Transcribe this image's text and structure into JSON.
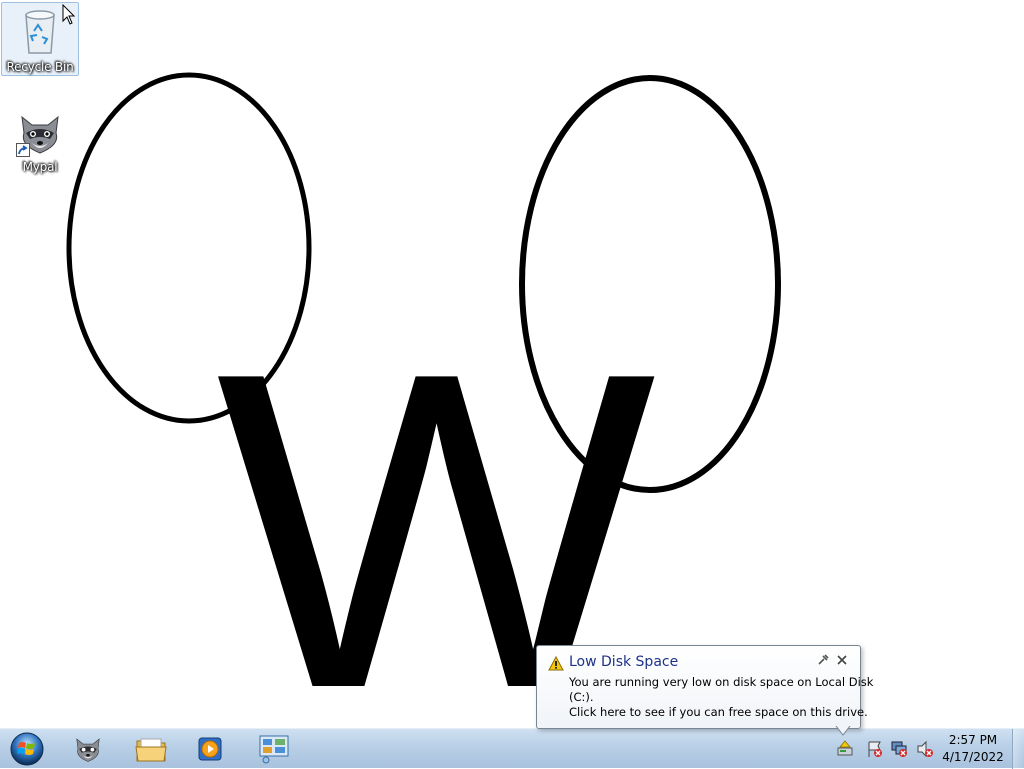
{
  "desktop": {
    "wallpaper_letter": "W",
    "icons": [
      {
        "label": "Recycle Bin",
        "icon": "recycle-bin-icon"
      },
      {
        "label": "Mypal",
        "icon": "raccoon-icon",
        "shortcut": true
      }
    ]
  },
  "notification": {
    "title": "Low Disk Space",
    "line1": "You are running very low on disk space on Local Disk",
    "line2": "(C:).",
    "line3": "Click here to see if you can free space on this drive.",
    "icon": "warning-icon"
  },
  "taskbar": {
    "start": "start-orb-icon",
    "pinned": [
      {
        "name": "Mypal",
        "icon": "raccoon-icon"
      },
      {
        "name": "Windows Explorer",
        "icon": "folder-icon"
      },
      {
        "name": "Windows Media Player",
        "icon": "media-player-icon"
      },
      {
        "name": "Control Panel",
        "icon": "control-panel-icon"
      }
    ],
    "tray_icons": [
      "disk-space-icon",
      "action-center-icon",
      "network-icon",
      "volume-muted-icon"
    ],
    "clock": {
      "time": "2:57 PM",
      "date": "4/17/2022"
    }
  },
  "colors": {
    "taskbar": "#b8cfe6",
    "balloon_title": "#1e3287",
    "warning": "#f2c811"
  }
}
